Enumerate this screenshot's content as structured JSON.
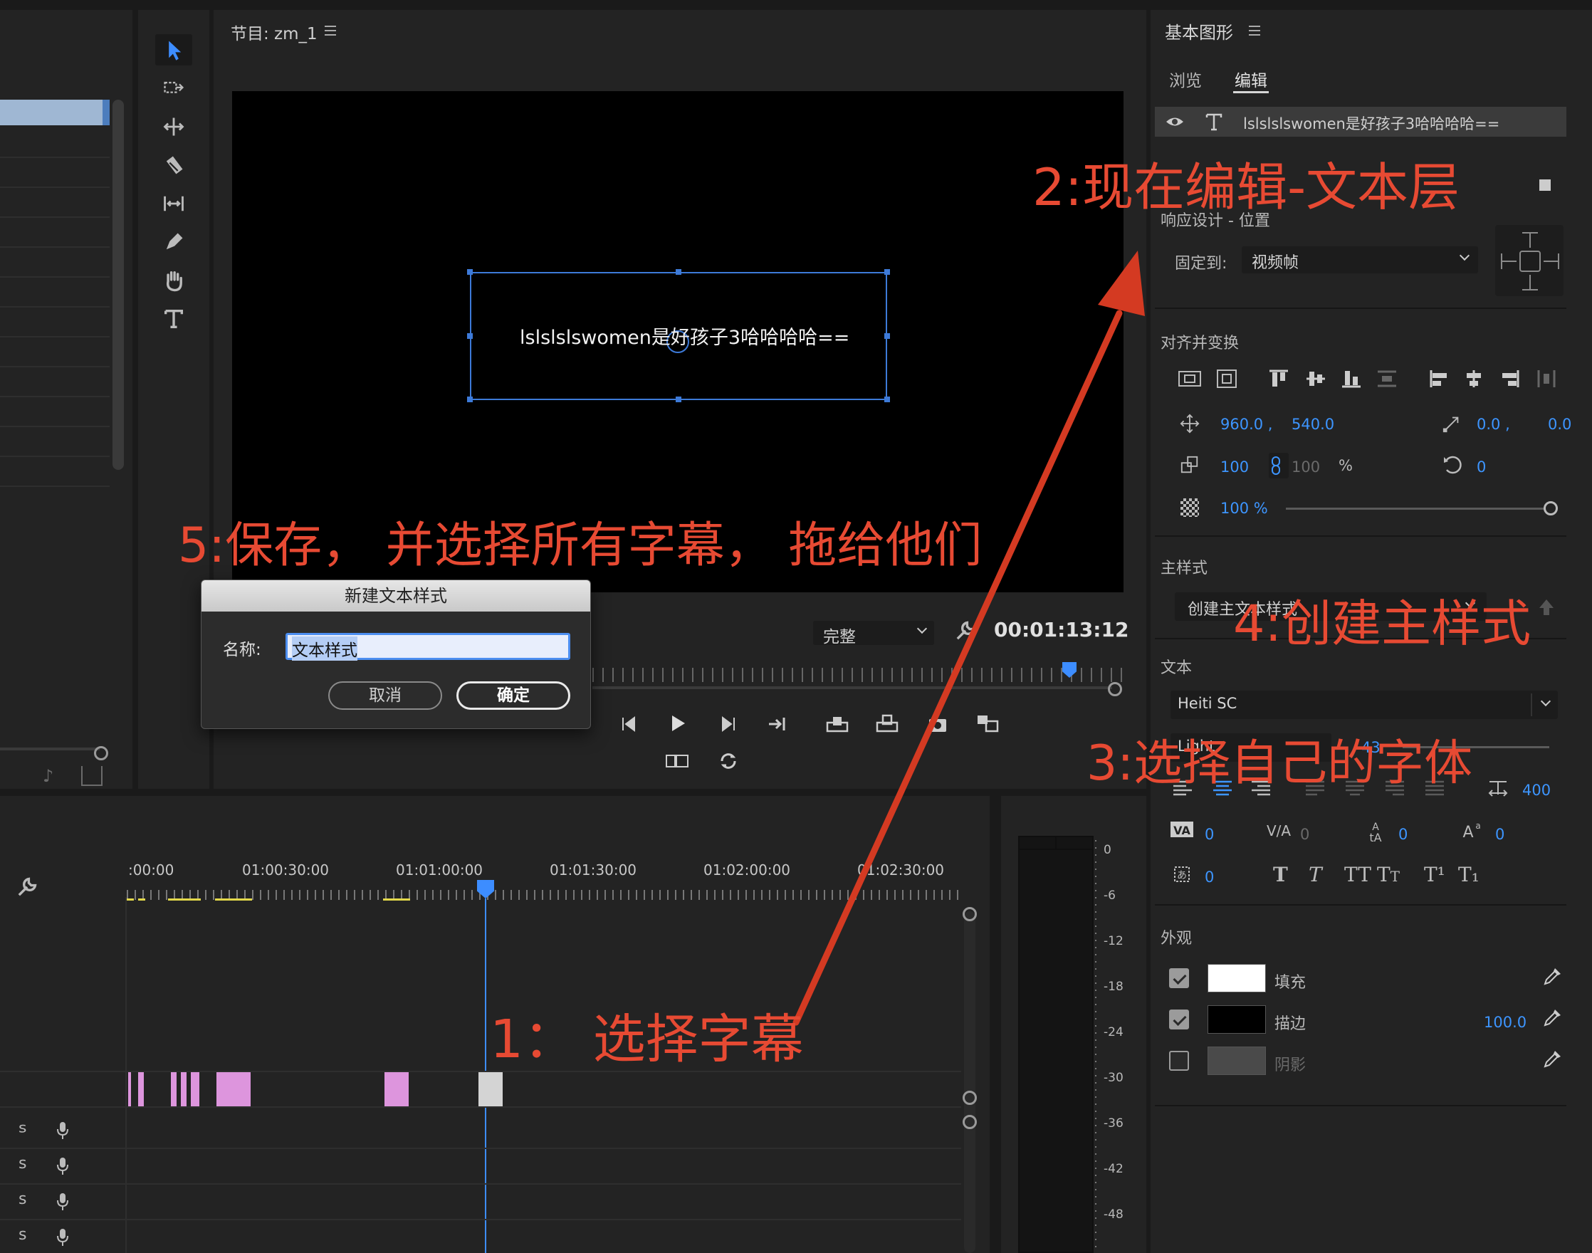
{
  "sequence_panel": {
    "title": "节目: zm_1",
    "menu_icon": "hamburger-icon"
  },
  "program_monitor": {
    "overlay_text": "lslslslswomen是好孩子3哈哈哈哈==",
    "quality": "完整",
    "timecode": "00:01:13:12"
  },
  "dialog": {
    "title": "新建文本样式",
    "name_label": "名称:",
    "name_value": "文本样式",
    "cancel": "取消",
    "ok": "确定"
  },
  "timeline": {
    "ruler": [
      ":00:00",
      "01:00:30:00",
      "01:01:00:00",
      "01:01:30:00",
      "01:02:00:00",
      "01:02:30:00"
    ],
    "tracks": [
      "S",
      "S",
      "S",
      "S"
    ]
  },
  "meter": {
    "scale": [
      "0",
      "-6",
      "-12",
      "-18",
      "-24",
      "-30",
      "-36",
      "-42",
      "-48"
    ]
  },
  "essential_graphics": {
    "title": "基本图形",
    "tabs": [
      "浏览",
      "编辑"
    ],
    "active_tab": "编辑",
    "layer_name": "lslslslswomen是好孩子3哈哈哈哈==",
    "responsive": {
      "heading": "响应设计 - 位置",
      "pin_label": "固定到:",
      "pin_value": "视频帧"
    },
    "align": {
      "heading": "对齐并变换",
      "pos_x": "960.0 ,",
      "pos_y": "540.0",
      "anchor_x": "0.0 ,",
      "anchor_y": "0.0",
      "scale_w": "100",
      "scale_h": "100",
      "scale_unit": "%",
      "rotation": "0",
      "opacity": "100 %"
    },
    "master_style": {
      "heading": "主样式",
      "value": "创建主文本样式"
    },
    "text": {
      "heading": "文本",
      "font": "Heiti SC",
      "font_style": "Light",
      "font_size": "43",
      "tracking_right": "400",
      "kerning": "0",
      "tracking": "0",
      "leading": "0",
      "baseline": "0",
      "tsume": "0",
      "style_buttons": [
        "T",
        "T",
        "TT",
        "Tt",
        "T¹",
        "T₁"
      ]
    },
    "appearance": {
      "heading": "外观",
      "fill_label": "填充",
      "stroke_label": "描边",
      "stroke_value": "100.0",
      "shadow_label": "阴影"
    }
  },
  "annotations": {
    "a1": "1： 选择字幕",
    "a2": "2:现在编辑-文本层",
    "a3": "3:选择自己的字体",
    "a4": "4:创建主样式",
    "a5": "5:保存， 并选择所有字幕， 拖给他们"
  },
  "colors": {
    "accent": "#3d95ff",
    "annotation": "#e74a33",
    "clip": "#dd95dd",
    "arrow": "#d43a22"
  }
}
